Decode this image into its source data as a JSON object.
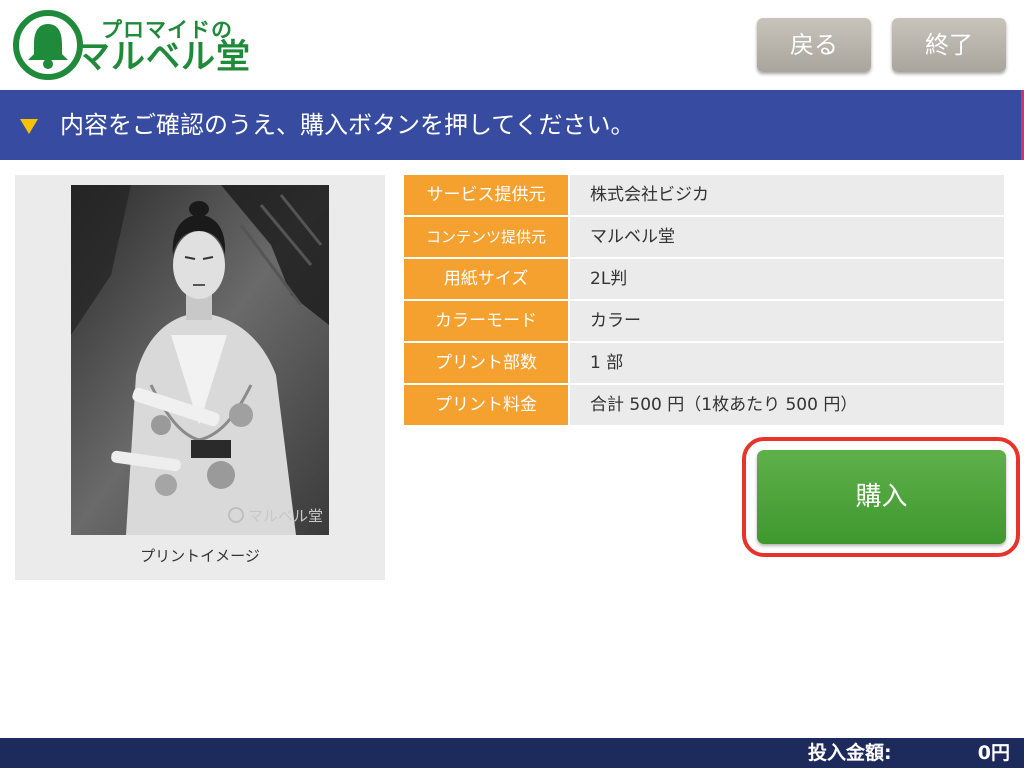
{
  "header": {
    "logo_line1": "プロマイドの",
    "logo_line2": "マルベル堂",
    "back_label": "戻る",
    "end_label": "終了"
  },
  "instruction": {
    "text": "内容をご確認のうえ、購入ボタンを押してください。"
  },
  "preview": {
    "caption": "プリントイメージ",
    "watermark": "マルベル堂"
  },
  "details": [
    {
      "label": "サービス提供元",
      "value": "株式会社ビジカ"
    },
    {
      "label": "コンテンツ提供元",
      "value": "マルベル堂"
    },
    {
      "label": "用紙サイズ",
      "value": "2L判"
    },
    {
      "label": "カラーモード",
      "value": "カラー"
    },
    {
      "label": "プリント部数",
      "value": "1 部"
    },
    {
      "label": "プリント料金",
      "value": "合計 500 円（1枚あたり 500 円）"
    }
  ],
  "purchase": {
    "label": "購入"
  },
  "footer": {
    "amount_label": "投入金額:",
    "amount_value": "0円"
  },
  "colors": {
    "brand_green": "#1f8a3a",
    "instruction_bar": "#374ba0",
    "label_orange": "#f4a130",
    "purchase_green": "#4aa33a",
    "highlight_red": "#e8332a",
    "footer_navy": "#1c2a5c"
  },
  "icons": {
    "logo": "bell-logo-icon",
    "instruction": "triangle-down-icon"
  }
}
